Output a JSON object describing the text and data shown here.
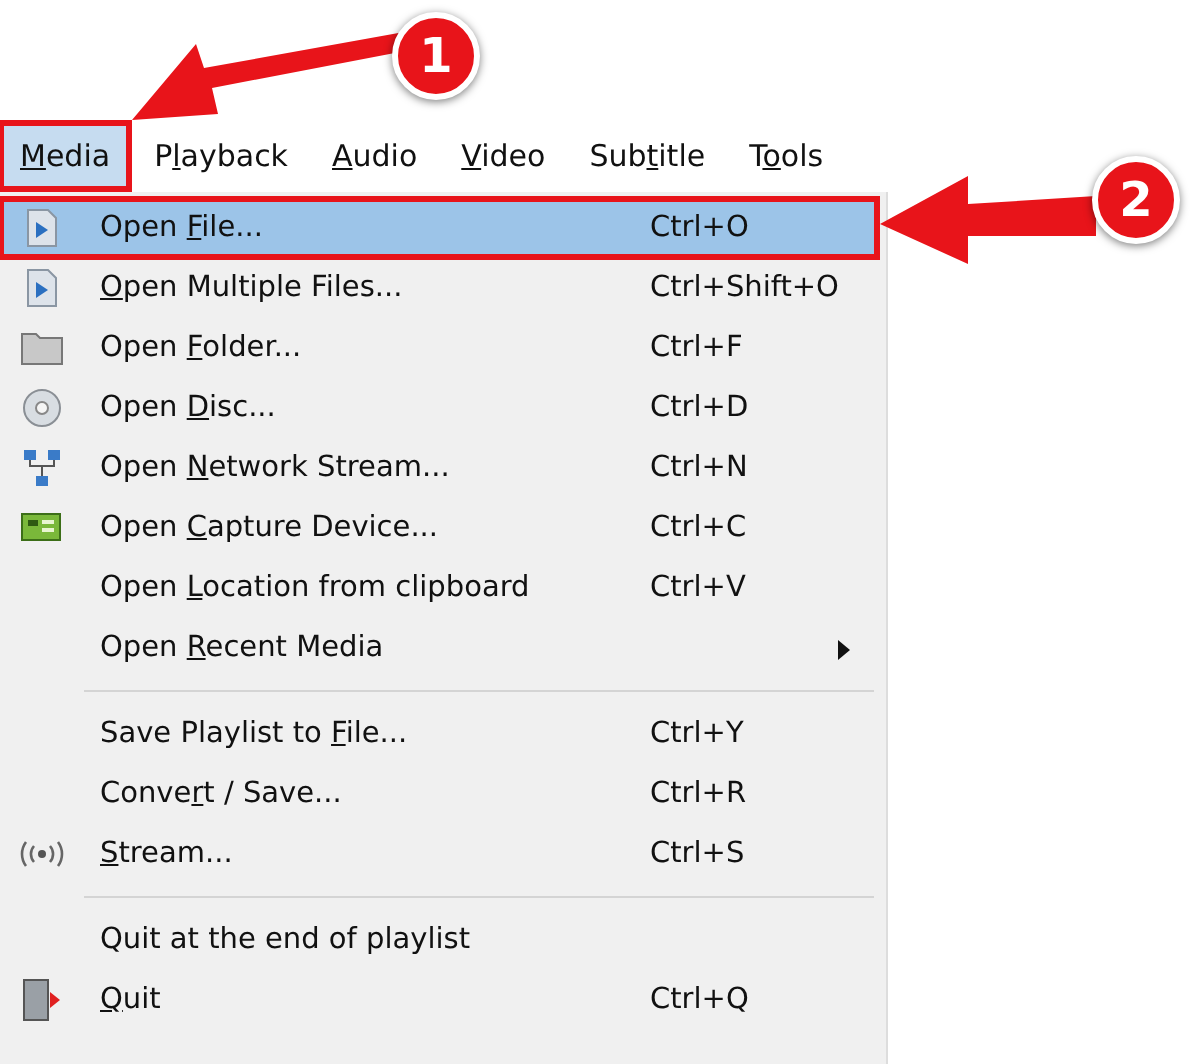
{
  "menubar": [
    {
      "label": {
        "key": "M",
        "post": "edia"
      },
      "selected": true
    },
    {
      "label": {
        "pre": "P",
        "key": "l",
        "post": "ayback"
      },
      "selected": false
    },
    {
      "label": {
        "key": "A",
        "post": "udio"
      },
      "selected": false
    },
    {
      "label": {
        "key": "V",
        "post": "ideo"
      },
      "selected": false
    },
    {
      "label": {
        "pre": "Sub",
        "key": "t",
        "post": "itle"
      },
      "selected": false
    },
    {
      "label": {
        "pre": "T",
        "key": "o",
        "post": "ols"
      },
      "selected": false
    }
  ],
  "menu": [
    {
      "kind": "item",
      "label": {
        "pre": "Open ",
        "key": "F",
        "post": "ile..."
      },
      "shortcut": "Ctrl+O",
      "selected": true
    },
    {
      "kind": "item",
      "label": {
        "key": "O",
        "post": "pen Multiple Files..."
      },
      "shortcut": "Ctrl+Shift+O",
      "selected": false
    },
    {
      "kind": "item",
      "label": {
        "pre": "Open ",
        "key": "F",
        "post": "older..."
      },
      "shortcut": "Ctrl+F",
      "selected": false
    },
    {
      "kind": "item",
      "label": {
        "pre": "Open ",
        "key": "D",
        "post": "isc..."
      },
      "shortcut": "Ctrl+D",
      "selected": false
    },
    {
      "kind": "item",
      "label": {
        "pre": "Open ",
        "key": "N",
        "post": "etwork Stream..."
      },
      "shortcut": "Ctrl+N",
      "selected": false
    },
    {
      "kind": "item",
      "label": {
        "pre": "Open ",
        "key": "C",
        "post": "apture Device..."
      },
      "shortcut": "Ctrl+C",
      "selected": false
    },
    {
      "kind": "item",
      "label": {
        "pre": "Open ",
        "key": "L",
        "post": "ocation from clipboard"
      },
      "shortcut": "Ctrl+V",
      "selected": false
    },
    {
      "kind": "item",
      "label": {
        "pre": "Open ",
        "key": "R",
        "post": "ecent Media"
      },
      "submenu": true,
      "selected": false
    },
    {
      "kind": "separator"
    },
    {
      "kind": "item",
      "label": {
        "pre": "Save Playlist to ",
        "key": "F",
        "post": "ile..."
      },
      "shortcut": "Ctrl+Y",
      "selected": false
    },
    {
      "kind": "item",
      "label": {
        "pre": "Conve",
        "key": "r",
        "post": "t / Save..."
      },
      "shortcut": "Ctrl+R",
      "selected": false
    },
    {
      "kind": "item",
      "label": {
        "key": "S",
        "post": "tream..."
      },
      "shortcut": "Ctrl+S",
      "selected": false
    },
    {
      "kind": "separator"
    },
    {
      "kind": "item",
      "label": {
        "pre": "Quit at the end of playlist"
      },
      "selected": false
    },
    {
      "kind": "item",
      "label": {
        "key": "Q",
        "post": "uit"
      },
      "shortcut": "Ctrl+Q",
      "selected": false
    }
  ],
  "annotations": [
    {
      "number": "1"
    },
    {
      "number": "2"
    }
  ]
}
